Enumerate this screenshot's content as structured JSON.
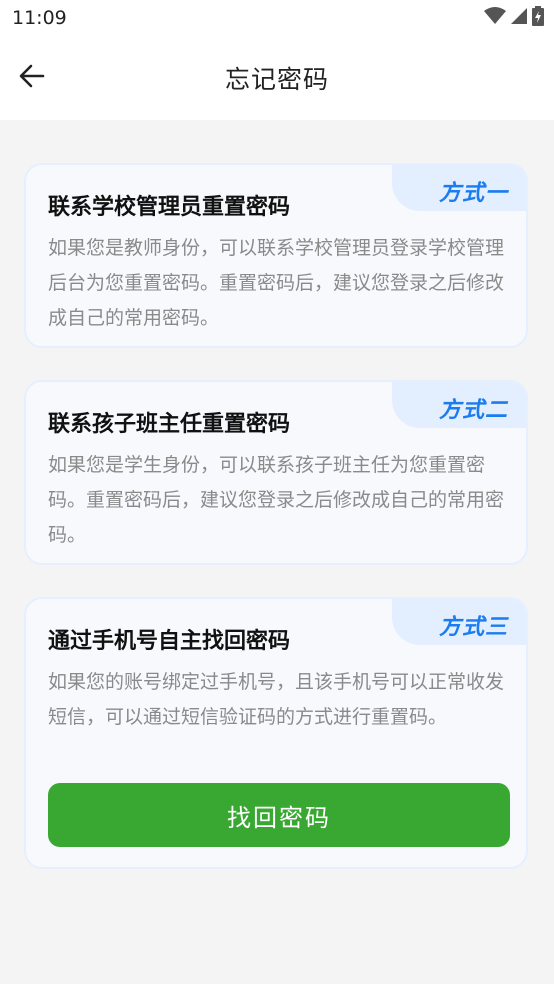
{
  "status_bar": {
    "time": "11:09",
    "icons": [
      "wifi-icon",
      "signal-icon",
      "battery-charging-icon"
    ]
  },
  "app_bar": {
    "back_icon": "arrow-left-icon",
    "title": "忘记密码"
  },
  "methods": [
    {
      "tag": "方式一",
      "title": "联系学校管理员重置密码",
      "description": "如果您是教师身份，可以联系学校管理员登录学校管理后台为您重置密码。重置密码后，建议您登录之后修改成自己的常用密码。"
    },
    {
      "tag": "方式二",
      "title": "联系孩子班主任重置密码",
      "description": "如果您是学生身份，可以联系孩子班主任为您重置密码。重置密码后，建议您登录之后修改成自己的常用密码。"
    },
    {
      "tag": "方式三",
      "title": "通过手机号自主找回密码",
      "description": "如果您的账号绑定过手机号，且该手机号可以正常收发短信，可以通过短信验证码的方式进行重置码。",
      "button_label": "找回密码"
    }
  ],
  "colors": {
    "accent_blue": "#1b7cf0",
    "tab_background": "#e3efff",
    "primary_green": "#38a832"
  }
}
